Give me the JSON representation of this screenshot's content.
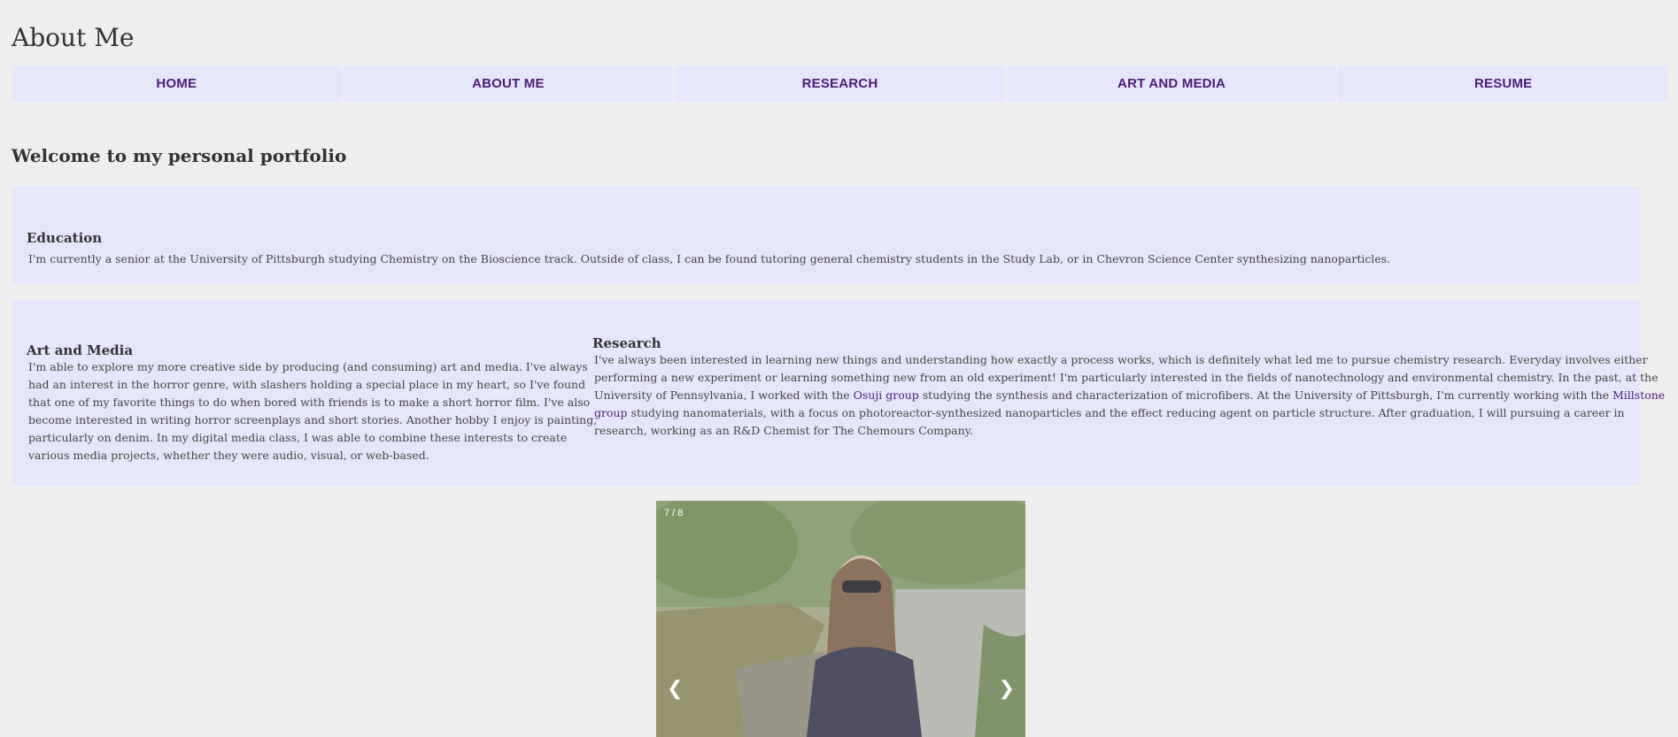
{
  "page": {
    "title": "About Me"
  },
  "nav": [
    "HOME",
    "ABOUT ME",
    "RESEARCH",
    "ART AND MEDIA",
    "RESUME"
  ],
  "welcome": "Welcome to my personal portfolio",
  "education": {
    "heading": "Education",
    "text": "I'm currently a senior at the University of Pittsburgh studying Chemistry on the Bioscience track. Outside of class, I can be found tutoring general chemistry students in the Study Lab, or in Chevron Science Center synthesizing nanoparticles."
  },
  "art": {
    "heading": "Art and Media",
    "text": "I'm able to explore my more creative side by producing (and consuming) art and media. I've always had an interest in the horror genre, with slashers holding a special place in my heart, so I've found that one of my favorite things to do when bored with friends is to make a short horror film. I've also become interested in writing horror screenplays and short stories. Another hobby I enjoy is painting, particularly on denim. In my digital media class, I was able to combine these interests to create various media projects, whether they were audio, visual, or web-based."
  },
  "research": {
    "heading": "Research",
    "text_1": "I've always been interested in learning new things and understanding how exactly a process works, which is definitely what led me to pursue chemistry research. Everyday involves either performing a new experiment or learning something new from an old experiment! I'm particularly interested in the fields of nanotechnology and environmental chemistry. In the past, at the University of Pennsylvania, I worked with the ",
    "link_1": "Osuji group",
    "text_2": " studying the synthesis and characterization of microfibers. At the University of Pittsburgh, I'm currently working with the ",
    "link_2": "Millstone group",
    "text_3": " studying nanomaterials, with a focus on photoreactor-synthesized nanoparticles and the effect reducing agent on particle structure. After graduation, I will pursuing a career in research, working as an R&D Chemist for The Chemours Company."
  },
  "slideshow": {
    "counter": "7 / 8",
    "prev_glyph": "❮",
    "next_glyph": "❯"
  }
}
